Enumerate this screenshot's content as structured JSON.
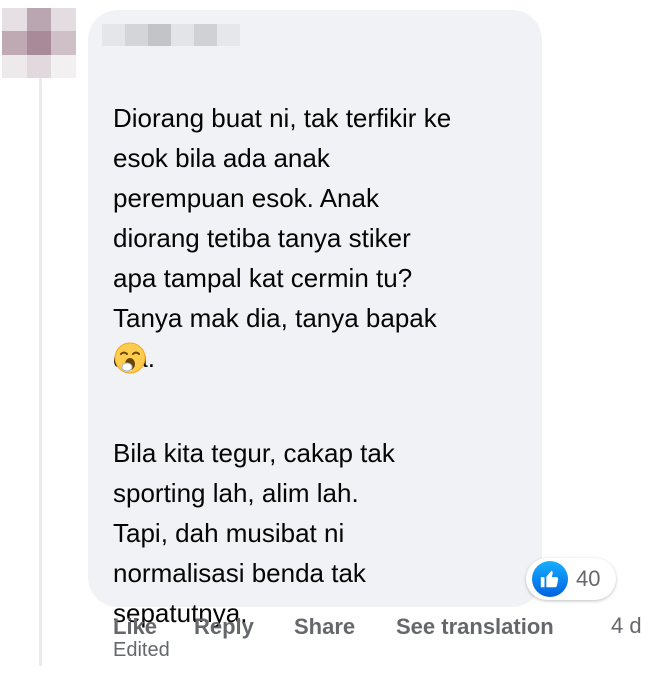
{
  "comment": {
    "paragraph_1": "Diorang buat ni, tak terfikir ke\nesok bila ada anak\nperempuan esok. Anak\ndiorang tetiba tanya stiker\napa tampal kat cermin tu?\nTanya mak dia, tanya bapak\ndia.",
    "emoji": "yawning-face-emoji",
    "paragraph_2": "Bila kita tegur, cakap tak\nsporting lah, alim lah.\nTapi, dah musibat ni\nnormalisasi benda tak\nsepatutnya."
  },
  "reactions": {
    "icon": "thumbs-up-icon",
    "count": "40",
    "color": "#1877f2"
  },
  "actions": {
    "like": "Like",
    "reply": "Reply",
    "share": "Share",
    "see_translation": "See translation"
  },
  "meta": {
    "timestamp": "4 d",
    "edited": "Edited"
  },
  "colors": {
    "bubble": "#f0f2f5",
    "text": "#050505",
    "secondary_text": "#65676b"
  }
}
